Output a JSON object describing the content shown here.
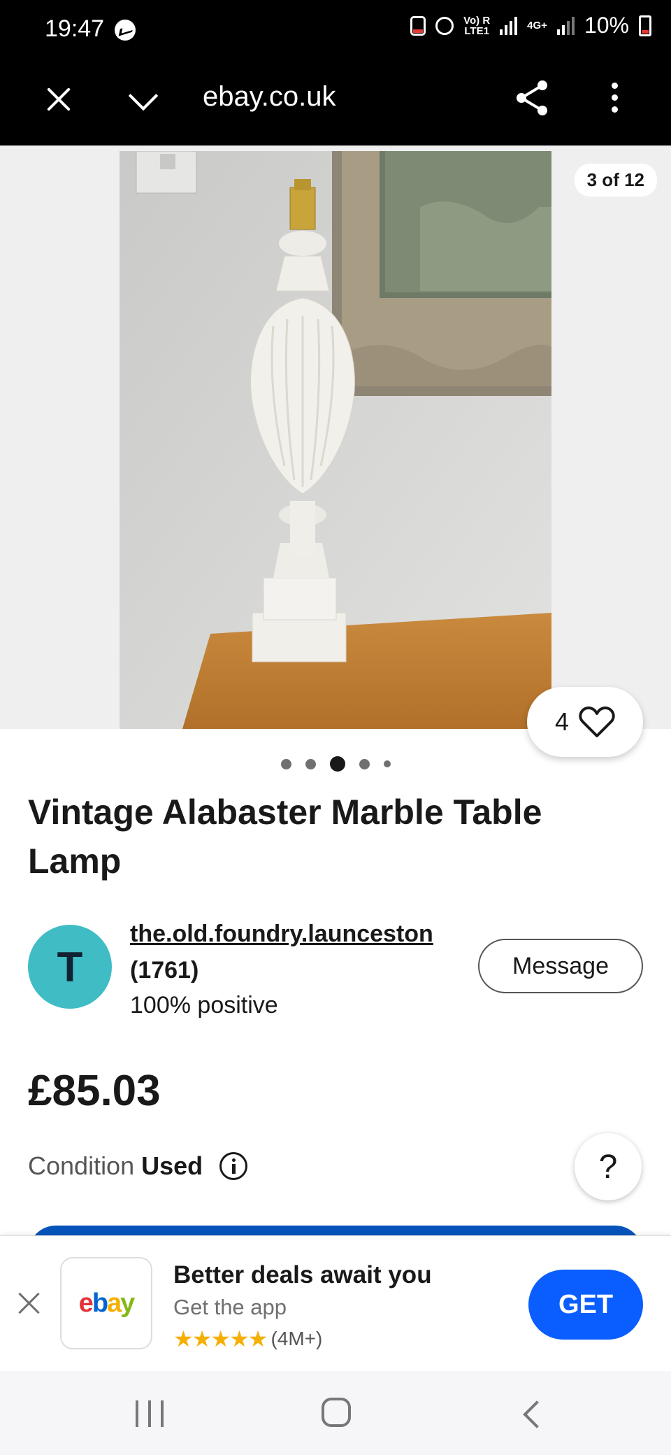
{
  "status_bar": {
    "time": "19:47",
    "network_label_1": "Vo) R",
    "network_label_2": "LTE1",
    "network_label_3": "4G+",
    "battery": "10%"
  },
  "browser": {
    "url": "ebay.co.uk"
  },
  "gallery": {
    "counter": "3 of 12",
    "watch_count": "4",
    "total_dots": 5,
    "active_dot": 3
  },
  "listing": {
    "title": "Vintage Alabaster Marble Table Lamp",
    "price": "£85.03",
    "condition_label": "Condition",
    "condition_value": "Used"
  },
  "seller": {
    "initial": "T",
    "avatar_color": "#3fbcc4",
    "name": "the.old.foundry.launceston",
    "count": "(1761)",
    "feedback": "100% positive",
    "message_label": "Message"
  },
  "help": {
    "label": "?"
  },
  "app_banner": {
    "logo_letters": [
      "e",
      "b",
      "a",
      "y"
    ],
    "title": "Better deals await you",
    "subtitle": "Get the app",
    "stars": "★★★★★",
    "rating_count": "(4M+)",
    "get_label": "GET",
    "accent": "#0a5eff"
  }
}
